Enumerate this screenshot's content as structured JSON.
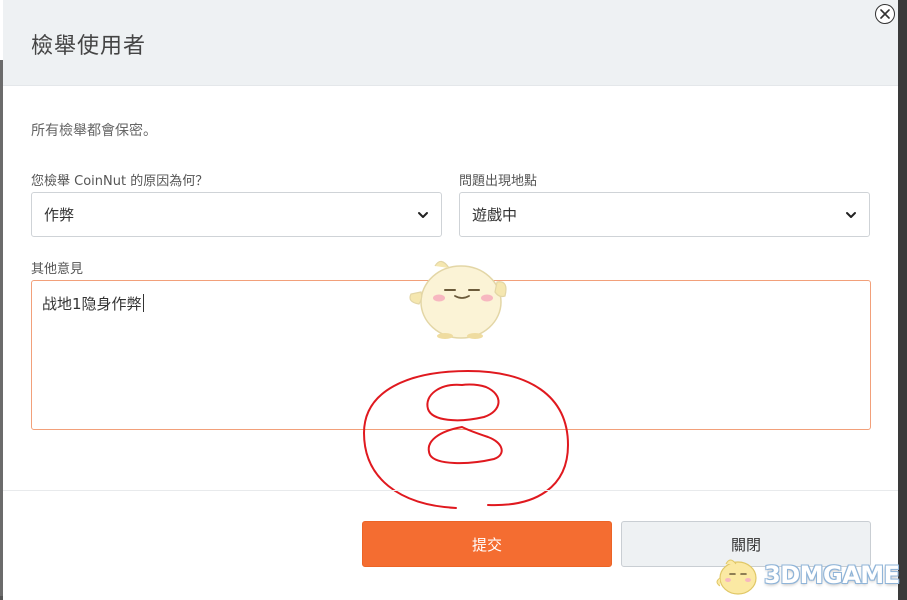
{
  "dialog": {
    "title": "檢舉使用者",
    "close_icon": "close-circle-icon"
  },
  "form": {
    "notice": "所有檢舉都會保密。",
    "reason": {
      "label": "您檢舉 CoinNut 的原因為何？",
      "selected": "作弊"
    },
    "location": {
      "label": "問題出現地點",
      "selected": "遊戲中"
    },
    "comments": {
      "label": "其他意見",
      "value": "战地1隐身作弊"
    }
  },
  "buttons": {
    "submit": "提交",
    "close": "關閉"
  },
  "watermark": {
    "text": "3DMGAME"
  },
  "colors": {
    "accent": "#f46d31",
    "header_bg": "#eef1f3",
    "annotation": "#e0191f"
  }
}
